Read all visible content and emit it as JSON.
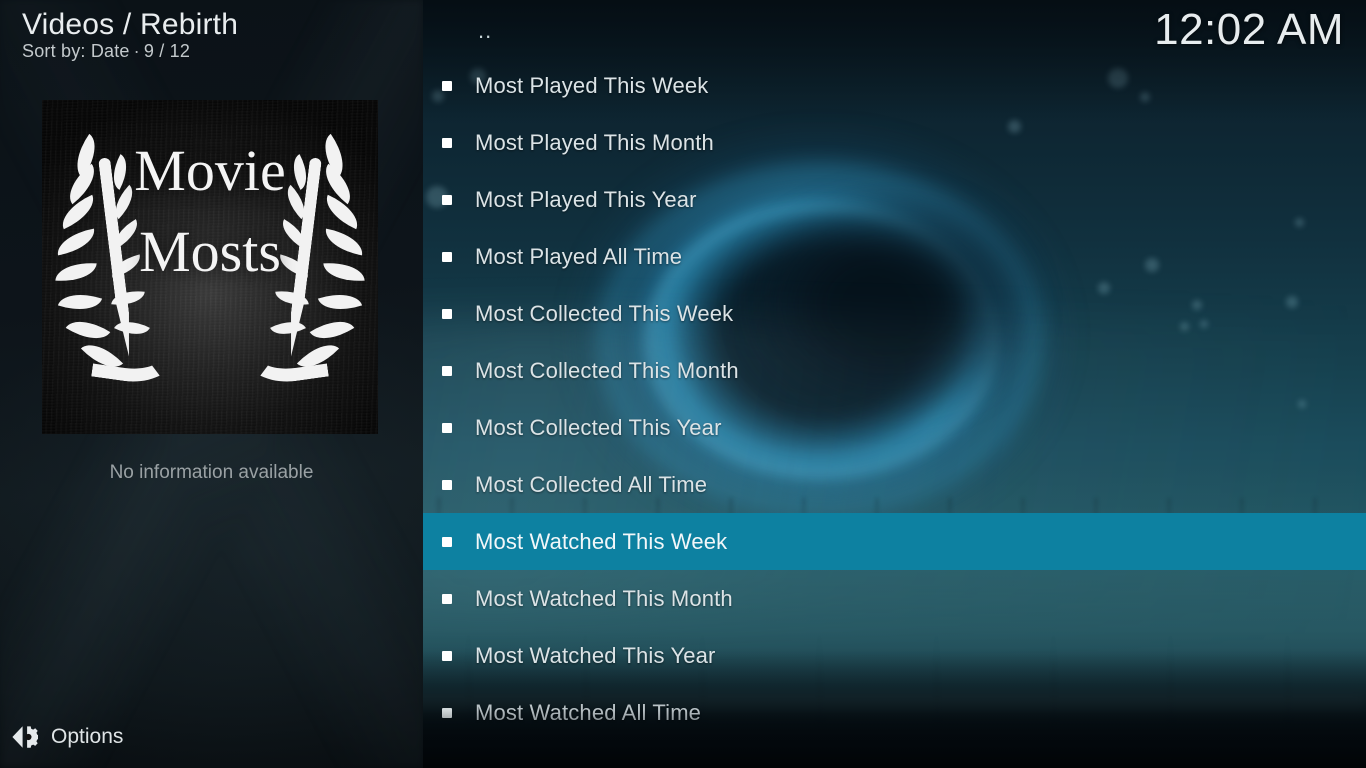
{
  "header": {
    "title": "Videos / Rebirth",
    "sort_prefix": "Sort by: Date",
    "separator": "·",
    "count": "9 / 12",
    "clock": "12:02 AM"
  },
  "sidebar": {
    "thumbnail": {
      "line1": "Movie",
      "line2": "Mosts",
      "icon": "laurel-wreath-icon"
    },
    "info_text": "No information available",
    "options": {
      "label": "Options",
      "icon": "left-chevron-gear-icon"
    }
  },
  "list": {
    "parent_item": "..",
    "selected_index": 8,
    "items": [
      {
        "label": "Most Played This Week",
        "bullet": "square-bullet-icon"
      },
      {
        "label": "Most Played This Month",
        "bullet": "square-bullet-icon"
      },
      {
        "label": "Most Played This Year",
        "bullet": "square-bullet-icon"
      },
      {
        "label": "Most Played All Time",
        "bullet": "square-bullet-icon"
      },
      {
        "label": "Most Collected This Week",
        "bullet": "square-bullet-icon"
      },
      {
        "label": "Most Collected This Month",
        "bullet": "square-bullet-icon"
      },
      {
        "label": "Most Collected This Year",
        "bullet": "square-bullet-icon"
      },
      {
        "label": "Most Collected All Time",
        "bullet": "square-bullet-icon"
      },
      {
        "label": "Most Watched This Week",
        "bullet": "square-bullet-icon"
      },
      {
        "label": "Most Watched This Month",
        "bullet": "square-bullet-icon"
      },
      {
        "label": "Most Watched This Year",
        "bullet": "square-bullet-icon"
      },
      {
        "label": "Most Watched All Time",
        "bullet": "square-bullet-icon"
      }
    ]
  },
  "colors": {
    "highlight": "#0d81a1",
    "sidebar_bg": "#0d141a",
    "text_primary": "#dbe3e6",
    "text_muted": "#9aa1a4"
  }
}
